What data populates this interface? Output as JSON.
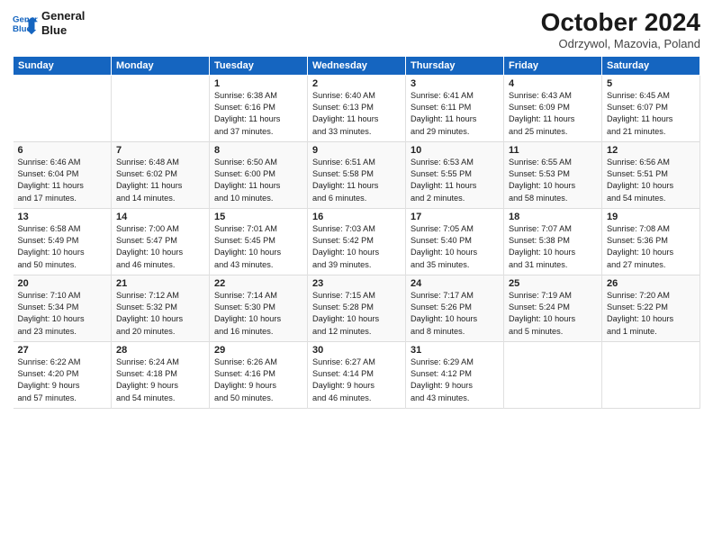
{
  "header": {
    "logo_line1": "General",
    "logo_line2": "Blue",
    "month_title": "October 2024",
    "subtitle": "Odrzywol, Mazovia, Poland"
  },
  "days_of_week": [
    "Sunday",
    "Monday",
    "Tuesday",
    "Wednesday",
    "Thursday",
    "Friday",
    "Saturday"
  ],
  "weeks": [
    [
      {
        "day": "",
        "info": ""
      },
      {
        "day": "",
        "info": ""
      },
      {
        "day": "1",
        "info": "Sunrise: 6:38 AM\nSunset: 6:16 PM\nDaylight: 11 hours\nand 37 minutes."
      },
      {
        "day": "2",
        "info": "Sunrise: 6:40 AM\nSunset: 6:13 PM\nDaylight: 11 hours\nand 33 minutes."
      },
      {
        "day": "3",
        "info": "Sunrise: 6:41 AM\nSunset: 6:11 PM\nDaylight: 11 hours\nand 29 minutes."
      },
      {
        "day": "4",
        "info": "Sunrise: 6:43 AM\nSunset: 6:09 PM\nDaylight: 11 hours\nand 25 minutes."
      },
      {
        "day": "5",
        "info": "Sunrise: 6:45 AM\nSunset: 6:07 PM\nDaylight: 11 hours\nand 21 minutes."
      }
    ],
    [
      {
        "day": "6",
        "info": "Sunrise: 6:46 AM\nSunset: 6:04 PM\nDaylight: 11 hours\nand 17 minutes."
      },
      {
        "day": "7",
        "info": "Sunrise: 6:48 AM\nSunset: 6:02 PM\nDaylight: 11 hours\nand 14 minutes."
      },
      {
        "day": "8",
        "info": "Sunrise: 6:50 AM\nSunset: 6:00 PM\nDaylight: 11 hours\nand 10 minutes."
      },
      {
        "day": "9",
        "info": "Sunrise: 6:51 AM\nSunset: 5:58 PM\nDaylight: 11 hours\nand 6 minutes."
      },
      {
        "day": "10",
        "info": "Sunrise: 6:53 AM\nSunset: 5:55 PM\nDaylight: 11 hours\nand 2 minutes."
      },
      {
        "day": "11",
        "info": "Sunrise: 6:55 AM\nSunset: 5:53 PM\nDaylight: 10 hours\nand 58 minutes."
      },
      {
        "day": "12",
        "info": "Sunrise: 6:56 AM\nSunset: 5:51 PM\nDaylight: 10 hours\nand 54 minutes."
      }
    ],
    [
      {
        "day": "13",
        "info": "Sunrise: 6:58 AM\nSunset: 5:49 PM\nDaylight: 10 hours\nand 50 minutes."
      },
      {
        "day": "14",
        "info": "Sunrise: 7:00 AM\nSunset: 5:47 PM\nDaylight: 10 hours\nand 46 minutes."
      },
      {
        "day": "15",
        "info": "Sunrise: 7:01 AM\nSunset: 5:45 PM\nDaylight: 10 hours\nand 43 minutes."
      },
      {
        "day": "16",
        "info": "Sunrise: 7:03 AM\nSunset: 5:42 PM\nDaylight: 10 hours\nand 39 minutes."
      },
      {
        "day": "17",
        "info": "Sunrise: 7:05 AM\nSunset: 5:40 PM\nDaylight: 10 hours\nand 35 minutes."
      },
      {
        "day": "18",
        "info": "Sunrise: 7:07 AM\nSunset: 5:38 PM\nDaylight: 10 hours\nand 31 minutes."
      },
      {
        "day": "19",
        "info": "Sunrise: 7:08 AM\nSunset: 5:36 PM\nDaylight: 10 hours\nand 27 minutes."
      }
    ],
    [
      {
        "day": "20",
        "info": "Sunrise: 7:10 AM\nSunset: 5:34 PM\nDaylight: 10 hours\nand 23 minutes."
      },
      {
        "day": "21",
        "info": "Sunrise: 7:12 AM\nSunset: 5:32 PM\nDaylight: 10 hours\nand 20 minutes."
      },
      {
        "day": "22",
        "info": "Sunrise: 7:14 AM\nSunset: 5:30 PM\nDaylight: 10 hours\nand 16 minutes."
      },
      {
        "day": "23",
        "info": "Sunrise: 7:15 AM\nSunset: 5:28 PM\nDaylight: 10 hours\nand 12 minutes."
      },
      {
        "day": "24",
        "info": "Sunrise: 7:17 AM\nSunset: 5:26 PM\nDaylight: 10 hours\nand 8 minutes."
      },
      {
        "day": "25",
        "info": "Sunrise: 7:19 AM\nSunset: 5:24 PM\nDaylight: 10 hours\nand 5 minutes."
      },
      {
        "day": "26",
        "info": "Sunrise: 7:20 AM\nSunset: 5:22 PM\nDaylight: 10 hours\nand 1 minute."
      }
    ],
    [
      {
        "day": "27",
        "info": "Sunrise: 6:22 AM\nSunset: 4:20 PM\nDaylight: 9 hours\nand 57 minutes."
      },
      {
        "day": "28",
        "info": "Sunrise: 6:24 AM\nSunset: 4:18 PM\nDaylight: 9 hours\nand 54 minutes."
      },
      {
        "day": "29",
        "info": "Sunrise: 6:26 AM\nSunset: 4:16 PM\nDaylight: 9 hours\nand 50 minutes."
      },
      {
        "day": "30",
        "info": "Sunrise: 6:27 AM\nSunset: 4:14 PM\nDaylight: 9 hours\nand 46 minutes."
      },
      {
        "day": "31",
        "info": "Sunrise: 6:29 AM\nSunset: 4:12 PM\nDaylight: 9 hours\nand 43 minutes."
      },
      {
        "day": "",
        "info": ""
      },
      {
        "day": "",
        "info": ""
      }
    ]
  ]
}
